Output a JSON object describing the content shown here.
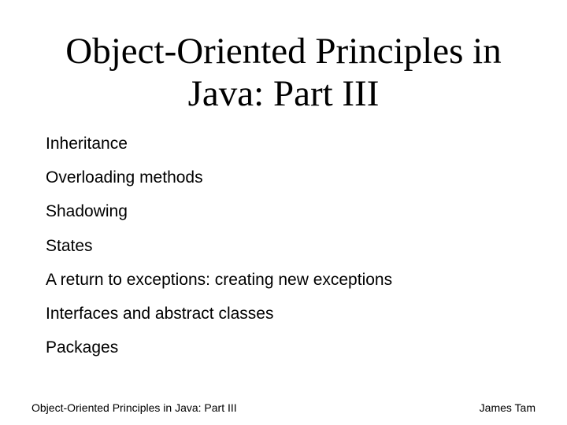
{
  "title": "Object-Oriented Principles in Java: Part III",
  "bullets": [
    "Inheritance",
    "Overloading methods",
    "Shadowing",
    "States",
    "A return to exceptions: creating new exceptions",
    "Interfaces and abstract classes",
    "Packages"
  ],
  "footer": {
    "left": "Object-Oriented Principles in Java: Part III",
    "right": "James Tam"
  }
}
